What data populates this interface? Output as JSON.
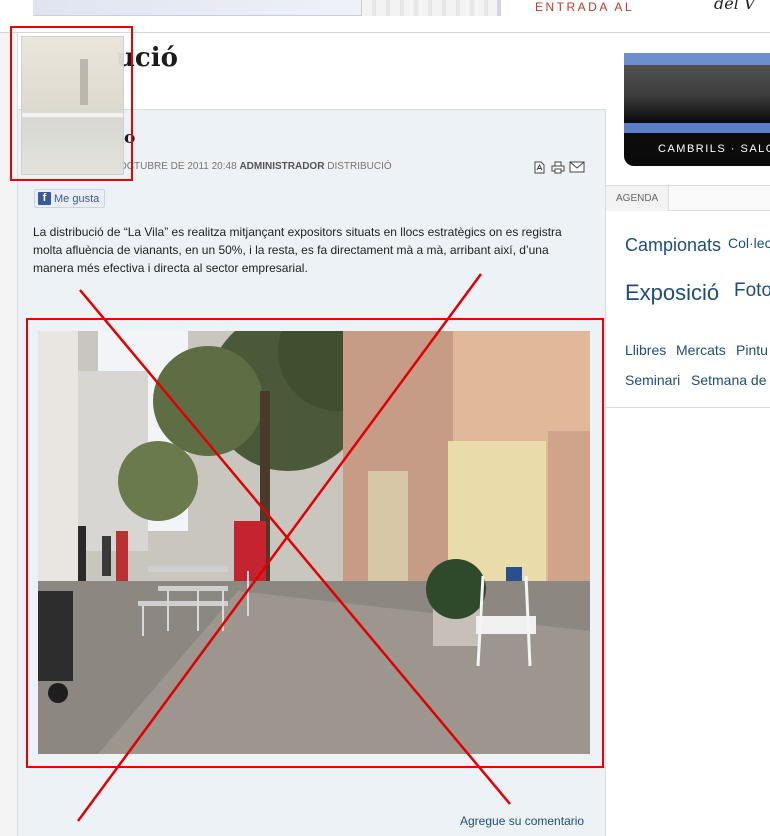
{
  "header": {
    "entrada_text": "ENTRADA AL",
    "entrada_logo_text": "del V"
  },
  "page_title_fragment": "ució",
  "article": {
    "title_fragment": "o",
    "meta": {
      "date": "OCTUBRE DE 2011 20:48",
      "author": "ADMINISTRADOR",
      "category": "DISTRIBUCIÓ"
    },
    "actions": [
      {
        "name": "pdf-icon",
        "glyph": "PDF"
      },
      {
        "name": "print-icon",
        "glyph": "print"
      },
      {
        "name": "email-icon",
        "glyph": "email"
      }
    ],
    "like_label": "Me gusta",
    "body": "La distribució de “La Vila” es realitza mitjançant expositors situats en llocs estratègics on es registra molta afluència de vianants, en un 50%, i la resta, es fa directament mà a mà, arribant així, d’una manera més efectiva i directa al sector empresarial.",
    "comment_link": "Agregue su comentario"
  },
  "sidebar": {
    "banner_text": "CAMBRILS  ·  SALO",
    "tab_label": "AGENDA",
    "tags": [
      {
        "label": "Campionats",
        "size": 18
      },
      {
        "label": "Col·lec",
        "size": 14
      },
      {
        "label": "Exposició",
        "size": 22
      },
      {
        "label": "Foto",
        "size": 19
      },
      {
        "label": "Llibres",
        "size": 14
      },
      {
        "label": "Mercats",
        "size": 14
      },
      {
        "label": "Pintu",
        "size": 14
      },
      {
        "label": "Seminari",
        "size": 14
      },
      {
        "label": "Setmana de",
        "size": 14
      }
    ]
  },
  "colors": {
    "link": "#1f4d7a",
    "annotation_red": "#e00000",
    "main_bg": "#edf2f7",
    "facebook_blue": "#3b5998"
  }
}
